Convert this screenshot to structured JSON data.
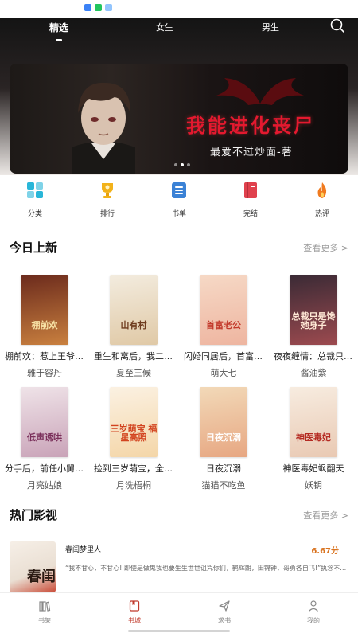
{
  "top_tabs": [
    {
      "label": "精选",
      "active": true
    },
    {
      "label": "女生",
      "active": false
    },
    {
      "label": "男生",
      "active": false
    }
  ],
  "banner": {
    "title": "我能进化丧尸",
    "author": "最爱不过炒面-著",
    "page_count": 5,
    "active_index": 1
  },
  "categories": [
    {
      "label": "分类",
      "icon": "grid-icon",
      "color": "#29b6d8"
    },
    {
      "label": "排行",
      "icon": "trophy-icon",
      "color": "#f2b21a"
    },
    {
      "label": "书单",
      "icon": "list-icon",
      "color": "#3b82d6"
    },
    {
      "label": "完结",
      "icon": "book-icon",
      "color": "#e0414d"
    },
    {
      "label": "热评",
      "icon": "fire-icon",
      "color": "#f07a1f"
    }
  ],
  "new_today": {
    "title": "今日上新",
    "more": "查看更多 >",
    "books": [
      {
        "title": "棚前欢：惹上王爷插翅难逃",
        "author": "雅于容丹",
        "cover_text": "棚前欢",
        "c1": "#6b2a1c",
        "c2": "#c9803f",
        "tc": "#f7e2a6"
      },
      {
        "title": "重生和离后，我二婚当皇后",
        "author": "夏至三候",
        "cover_text": "山有村",
        "c1": "#f3ecdf",
        "c2": "#e0c9a6",
        "tc": "#6e3b1e"
      },
      {
        "title": "闪婚同居后，首富老公宠妻",
        "author": "萌大七",
        "cover_text": "首富老公",
        "c1": "#f6d9c6",
        "c2": "#eeb5a0",
        "tc": "#c2392b"
      },
      {
        "title": "夜夜缠情：总裁只是馋她身子",
        "author": "酱油紫",
        "cover_text": "总裁只是馋她身子",
        "c1": "#3a2a35",
        "c2": "#9c4a4f",
        "tc": "#ffe9d6"
      },
      {
        "title": "分手后，前任小舅对我低声诱哄",
        "author": "月亮姑娘",
        "cover_text": "低声诱哄",
        "c1": "#efe3e8",
        "c2": "#c9a3b8",
        "tc": "#7a2f5a"
      },
      {
        "title": "捡到三岁萌宝，全家福星高照",
        "author": "月洗梧桐",
        "cover_text": "三岁萌宝 福星高照",
        "c1": "#fbf1e2",
        "c2": "#f4d6a8",
        "tc": "#d2431f"
      },
      {
        "title": "日夜沉溺",
        "author": "猫猫不吃鱼",
        "cover_text": "日夜沉溺",
        "c1": "#f2d9b8",
        "c2": "#e7a782",
        "tc": "#ffffff"
      },
      {
        "title": "神医毒妃飒翻天",
        "author": "妖钥",
        "cover_text": "神医毒妃",
        "c1": "#f7ece0",
        "c2": "#e9c9b3",
        "tc": "#b52a22"
      }
    ]
  },
  "hot_video": {
    "title": "热门影视",
    "more": "查看更多 >",
    "item": {
      "title": "春闺梦里人",
      "score": "6.67分",
      "description": "“我不甘心，不甘心! 即使是做鬼我也要生生世世诅咒你们，鹤辉朗，田锦钟，哥勇各自飞!”执念不散，冤魂难离",
      "thumb_text": "春闺"
    }
  },
  "bottom_nav": [
    {
      "label": "书架",
      "icon": "bookshelf-icon",
      "active": false
    },
    {
      "label": "书城",
      "icon": "bookstore-icon",
      "active": true
    },
    {
      "label": "求书",
      "icon": "send-icon",
      "active": false
    },
    {
      "label": "我的",
      "icon": "user-icon",
      "active": false
    }
  ],
  "colors": {
    "accent": "#c0392b",
    "banner_title": "#e4192f",
    "score": "#d9731f"
  }
}
